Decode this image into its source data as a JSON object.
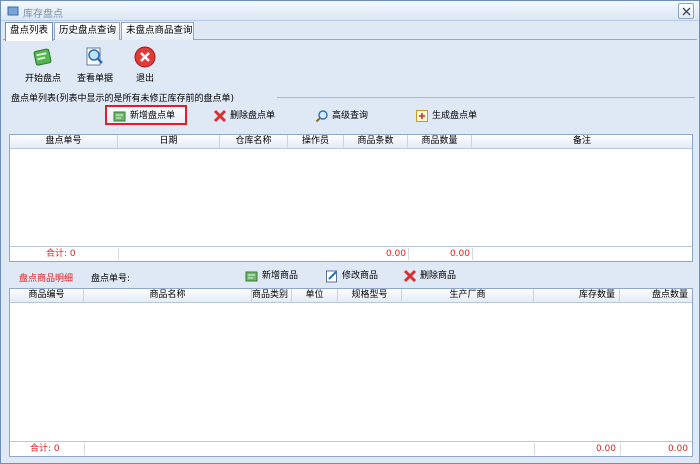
{
  "window": {
    "title": "库存盘点"
  },
  "tabs": [
    {
      "label": "盘点列表"
    },
    {
      "label": "历史盘点查询"
    },
    {
      "label": "未盘点商品查询"
    }
  ],
  "toolbar": {
    "start_label": "开始盘点",
    "view_label": "查看单据",
    "exit_label": "退出"
  },
  "list_section": {
    "label": "盘点单列表(列表中显示的是所有未修正库存前的盘点单)",
    "actions": {
      "add": "新增盘点单",
      "delete": "删除盘点单",
      "search": "高级查询",
      "generate": "生成盘点单"
    },
    "columns": [
      "盘点单号",
      "日期",
      "仓库名称",
      "操作员",
      "商品条数",
      "商品数量",
      "备注"
    ],
    "footer": {
      "total_label": "合计: 0",
      "items_total": "0.00",
      "qty_total": "0.00"
    }
  },
  "detail_section": {
    "title": "盘点商品明细",
    "code_label": "盘点单号:",
    "actions": {
      "add": "新增商品",
      "edit": "修改商品",
      "delete": "删除商品"
    },
    "columns": [
      "商品编号",
      "商品名称",
      "商品类别",
      "单位",
      "规格型号",
      "生产厂商",
      "库存数量",
      "盘点数量"
    ],
    "footer": {
      "total_label": "合计: 0",
      "stock_total": "0.00",
      "count_total": "0.00"
    }
  }
}
